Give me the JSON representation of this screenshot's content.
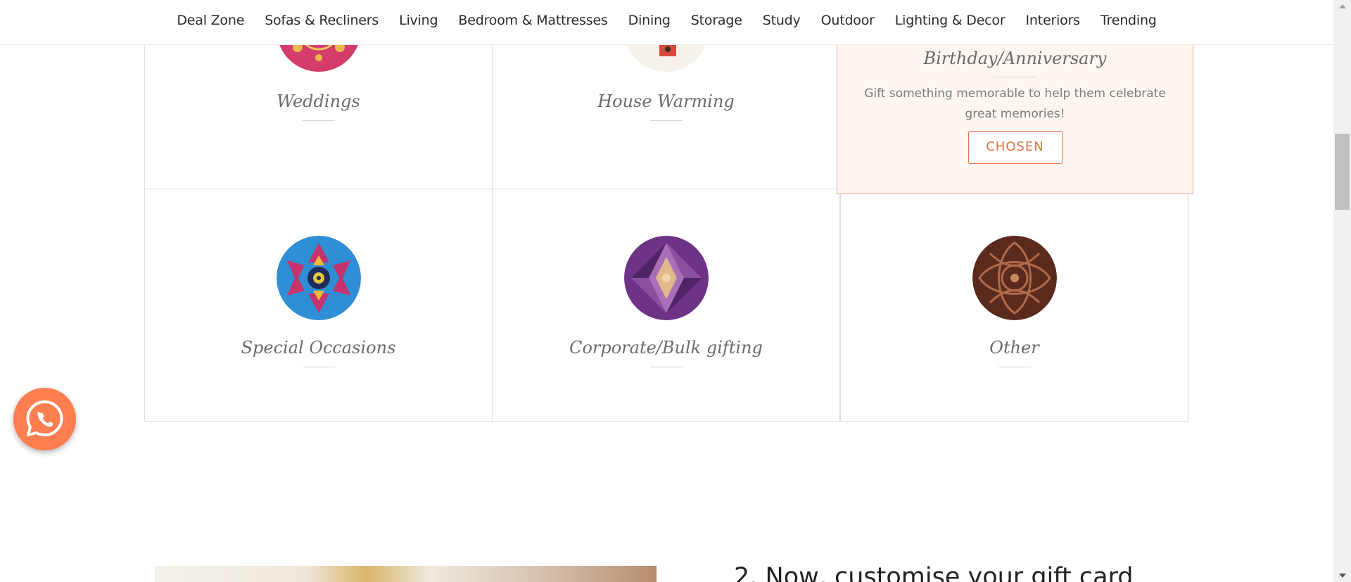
{
  "nav": {
    "items": [
      "Deal Zone",
      "Sofas & Recliners",
      "Living",
      "Bedroom & Mattresses",
      "Dining",
      "Storage",
      "Study",
      "Outdoor",
      "Lighting & Decor",
      "Interiors",
      "Trending"
    ]
  },
  "occasions": {
    "weddings": {
      "label": "Weddings",
      "icon": "wedding-pattern-icon"
    },
    "house_warming": {
      "label": "House Warming",
      "icon": "birdhouse-pattern-icon"
    },
    "birthday": {
      "label": "Birthday/Anniversary",
      "description": "Gift something memorable to help them celebrate great memories!",
      "button": "CHOSEN",
      "selected": true
    },
    "special": {
      "label": "Special Occasions",
      "icon": "kaleidoscope-icon"
    },
    "corporate": {
      "label": "Corporate/Bulk gifting",
      "icon": "purple-crystal-icon"
    },
    "other": {
      "label": "Other",
      "icon": "copper-filigree-icon"
    }
  },
  "step2": {
    "heading": "2. Now, customise your gift card"
  },
  "colors": {
    "accent": "#e2703e",
    "selected_bg": "#fdf6f1",
    "whatsapp_bg": "#ff7e4f"
  }
}
